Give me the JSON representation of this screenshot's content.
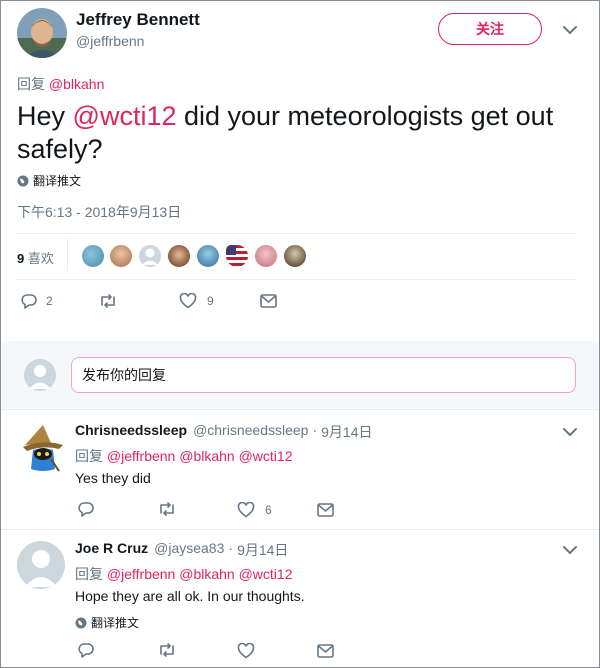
{
  "main": {
    "author_name": "Jeffrey Bennett",
    "author_handle": "@jeffrbenn",
    "follow_label": "关注",
    "reply_prefix": "回复",
    "reply_to": "@blkahn",
    "text_before": "Hey ",
    "text_mention": "@wcti12",
    "text_after": " did your meteorologists get out safely?",
    "translate_label": "翻译推文",
    "timestamp": "下午6:13 - 2018年9月13日",
    "likes_count": "9",
    "likes_label": "喜欢",
    "actions": {
      "reply_count": "2",
      "like_count": "9"
    }
  },
  "compose": {
    "placeholder": "发布你的回复"
  },
  "replies": [
    {
      "name": "Chrisneedssleep",
      "handle": "@chrisneedssleep",
      "sep": "·",
      "date": "9月14日",
      "reply_prefix": "回复",
      "mentions": [
        "@jeffrbenn",
        "@blkahn",
        "@wcti12"
      ],
      "text": "Yes they did",
      "like_count": "6"
    },
    {
      "name": "Joe R Cruz",
      "handle": "@jaysea83",
      "sep": "·",
      "date": "9月14日",
      "reply_prefix": "回复",
      "mentions": [
        "@jeffrbenn",
        "@blkahn",
        "@wcti12"
      ],
      "text": "Hope they are all ok. In our thoughts.",
      "translate_label": "翻译推文"
    }
  ],
  "colors": {
    "accent": "#e0245e",
    "secondary_text": "#657786",
    "divider": "#e6ecf0"
  }
}
